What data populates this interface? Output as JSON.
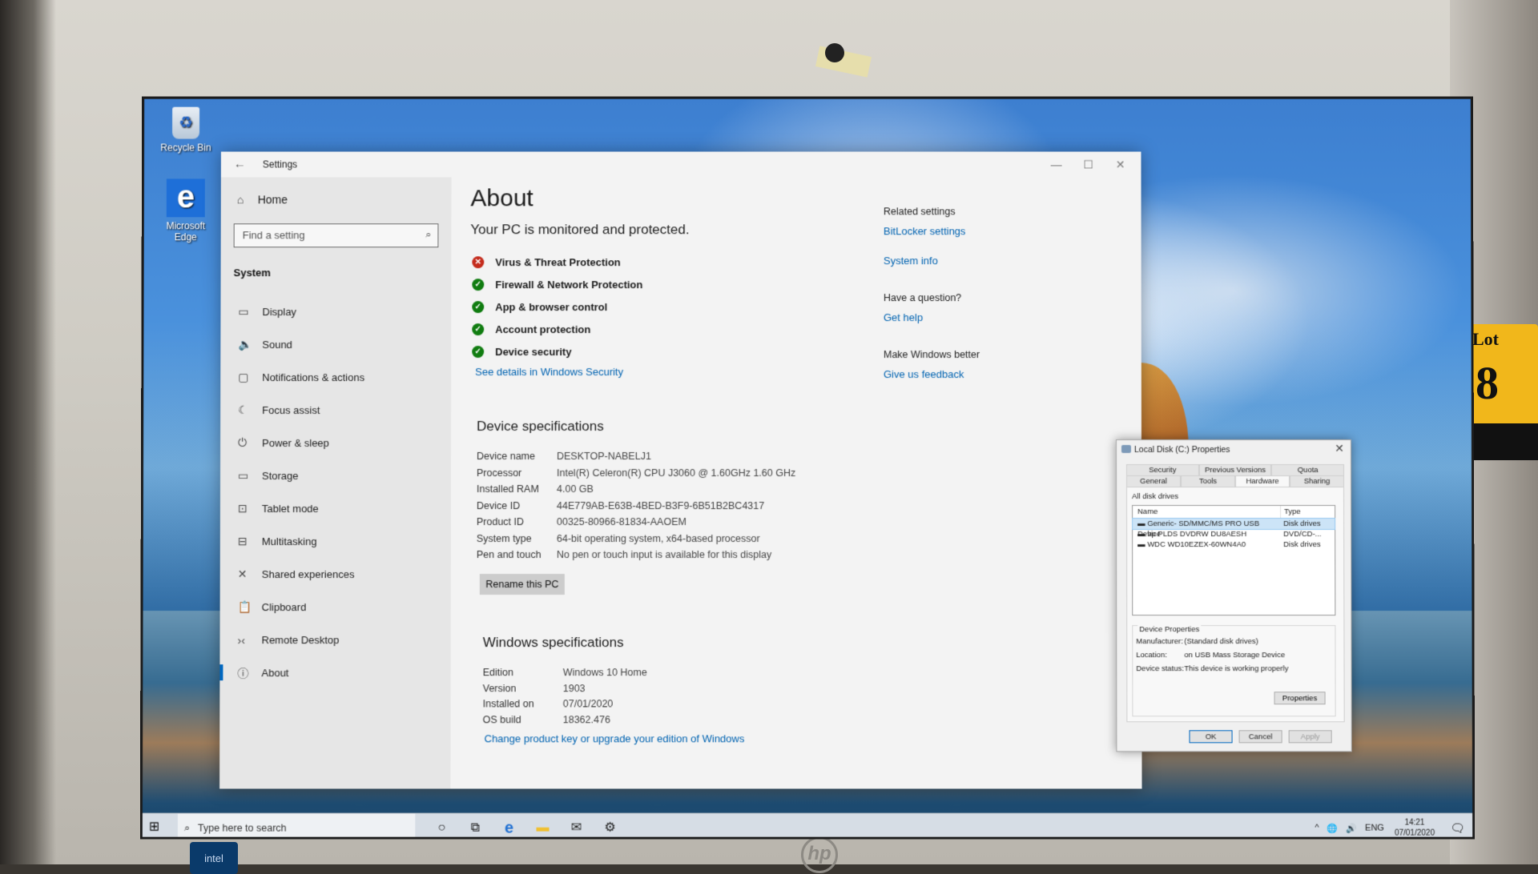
{
  "desktop": {
    "icons": [
      {
        "label": "Recycle Bin",
        "icon": "recycle-bin-icon"
      },
      {
        "label": "Microsoft Edge",
        "icon": "edge-icon"
      }
    ]
  },
  "monitor": {
    "brand": "hp",
    "badge": "intel",
    "sticker_text": "Lot",
    "sticker_number": "8"
  },
  "settings": {
    "window_title": "Settings",
    "back_icon": "←",
    "controls": {
      "minimize": "—",
      "maximize": "☐",
      "close": "✕"
    },
    "sidebar": {
      "home_label": "Home",
      "search_placeholder": "Find a setting",
      "section_label": "System",
      "items": [
        {
          "label": "Display",
          "icon": "display-icon",
          "glyph": "▭",
          "active": false
        },
        {
          "label": "Sound",
          "icon": "sound-icon",
          "glyph": "🔈",
          "active": false
        },
        {
          "label": "Notifications & actions",
          "icon": "notifications-icon",
          "glyph": "▢",
          "active": false
        },
        {
          "label": "Focus assist",
          "icon": "focus-assist-icon",
          "glyph": "☾",
          "active": false
        },
        {
          "label": "Power & sleep",
          "icon": "power-icon",
          "glyph": "⏻",
          "active": false
        },
        {
          "label": "Storage",
          "icon": "storage-icon",
          "glyph": "▭",
          "active": false
        },
        {
          "label": "Tablet mode",
          "icon": "tablet-mode-icon",
          "glyph": "⊡",
          "active": false
        },
        {
          "label": "Multitasking",
          "icon": "multitasking-icon",
          "glyph": "⊟",
          "active": false
        },
        {
          "label": "Shared experiences",
          "icon": "shared-experiences-icon",
          "glyph": "✕",
          "active": false
        },
        {
          "label": "Clipboard",
          "icon": "clipboard-icon",
          "glyph": "📋",
          "active": false
        },
        {
          "label": "Remote Desktop",
          "icon": "remote-desktop-icon",
          "glyph": "›‹",
          "active": false
        },
        {
          "label": "About",
          "icon": "info-icon",
          "glyph": "ⓘ",
          "active": true
        }
      ]
    },
    "about": {
      "title": "About",
      "protection_heading": "Your PC is monitored and protected.",
      "protection_items": [
        {
          "label": "Virus & Threat Protection",
          "status": "bad"
        },
        {
          "label": "Firewall & Network Protection",
          "status": "ok"
        },
        {
          "label": "App & browser control",
          "status": "ok"
        },
        {
          "label": "Account protection",
          "status": "ok"
        },
        {
          "label": "Device security",
          "status": "ok"
        }
      ],
      "see_details_link": "See details in Windows Security",
      "device_specs_heading": "Device specifications",
      "device_specs": [
        {
          "key": "Device name",
          "value": "DESKTOP-NABELJ1"
        },
        {
          "key": "Processor",
          "value": "Intel(R) Celeron(R) CPU  J3060  @ 1.60GHz   1.60 GHz"
        },
        {
          "key": "Installed RAM",
          "value": "4.00 GB"
        },
        {
          "key": "Device ID",
          "value": "44E779AB-E63B-4BED-B3F9-6B51B2BC4317"
        },
        {
          "key": "Product ID",
          "value": "00325-80966-81834-AAOEM"
        },
        {
          "key": "System type",
          "value": "64-bit operating system, x64-based processor"
        },
        {
          "key": "Pen and touch",
          "value": "No pen or touch input is available for this display"
        }
      ],
      "rename_button": "Rename this PC",
      "windows_specs_heading": "Windows specifications",
      "windows_specs": [
        {
          "key": "Edition",
          "value": "Windows 10 Home"
        },
        {
          "key": "Version",
          "value": "1903"
        },
        {
          "key": "Installed on",
          "value": "07/01/2020"
        },
        {
          "key": "OS build",
          "value": "18362.476"
        }
      ],
      "change_key_link": "Change product key or upgrade your edition of Windows",
      "related": {
        "related_heading": "Related settings",
        "bitlocker_link": "BitLocker settings",
        "system_info_link": "System info",
        "question_heading": "Have a question?",
        "get_help_link": "Get help",
        "better_heading": "Make Windows better",
        "feedback_link": "Give us feedback"
      }
    }
  },
  "properties_dialog": {
    "title": "Local Disk (C:) Properties",
    "close": "✕",
    "tabs_row1": [
      "Security",
      "Previous Versions",
      "Quota"
    ],
    "tabs_row2": [
      "General",
      "Tools",
      "Hardware",
      "Sharing"
    ],
    "selected_tab": "Hardware",
    "list_label": "All disk drives",
    "columns": [
      "Name",
      "Type"
    ],
    "drives": [
      {
        "name": "Generic- SD/MMC/MS PRO USB Device",
        "type": "Disk drives",
        "selected": true
      },
      {
        "name": "hp PLDS DVDRW  DU8AESH",
        "type": "DVD/CD-...",
        "selected": false
      },
      {
        "name": "WDC WD10EZEX-60WN4A0",
        "type": "Disk drives",
        "selected": false
      }
    ],
    "device_properties": {
      "legend": "Device Properties",
      "manufacturer_label": "Manufacturer:",
      "manufacturer": "(Standard disk drives)",
      "location_label": "Location:",
      "location": "on USB Mass Storage Device",
      "status_label": "Device status:",
      "status": "This device is working properly",
      "properties_button": "Properties"
    },
    "buttons": {
      "ok": "OK",
      "cancel": "Cancel",
      "apply": "Apply"
    }
  },
  "taskbar": {
    "search_placeholder": "Type here to search",
    "pinned": [
      {
        "name": "cortana-icon",
        "glyph": "○"
      },
      {
        "name": "task-view-icon",
        "glyph": "⧉"
      },
      {
        "name": "edge-icon",
        "glyph": "e"
      },
      {
        "name": "file-explorer-icon",
        "glyph": "▬"
      },
      {
        "name": "mail-icon",
        "glyph": "✉"
      },
      {
        "name": "settings-icon",
        "glyph": "⚙"
      }
    ],
    "tray": {
      "chevron": "^",
      "network": "🌐",
      "volume": "🔊",
      "language": "ENG",
      "time": "14:21",
      "date": "07/01/2020",
      "notification": "🗨"
    }
  }
}
